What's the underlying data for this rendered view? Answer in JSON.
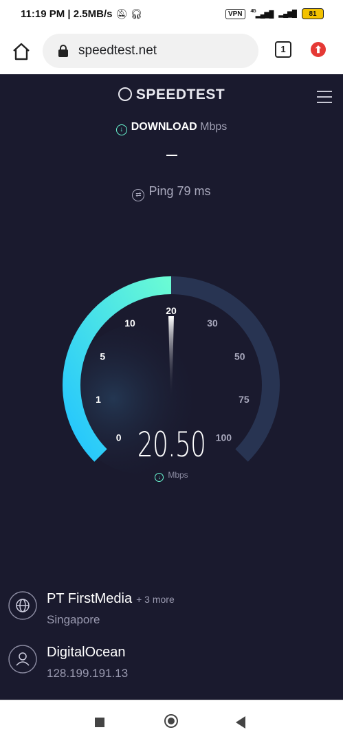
{
  "status_bar": {
    "time": "11:19 PM",
    "separator": "|",
    "data_rate": "2.5MB/s",
    "vpn": "VPN",
    "net": "4G",
    "battery": "81"
  },
  "browser": {
    "url": "speedtest.net",
    "tab_count": "1"
  },
  "app": {
    "brand": "SPEEDTEST",
    "test_label": "DOWNLOAD",
    "unit": "Mbps",
    "dash": "—",
    "ping": "Ping 79 ms"
  },
  "gauge": {
    "ticks": [
      "0",
      "1",
      "5",
      "10",
      "20",
      "30",
      "50",
      "75",
      "100"
    ],
    "current_value": "20.50",
    "unit": "Mbps",
    "progress_fraction": 0.5
  },
  "server": {
    "isp": "PT FirstMedia",
    "isp_more": "+ 3 more",
    "location": "Singapore",
    "host": "DigitalOcean",
    "ip": "128.199.191.13"
  },
  "colors": {
    "background": "#1a1a2e",
    "arc_start": "#22c4ff",
    "arc_end": "#6afbd4",
    "arc_track": "#283452"
  }
}
